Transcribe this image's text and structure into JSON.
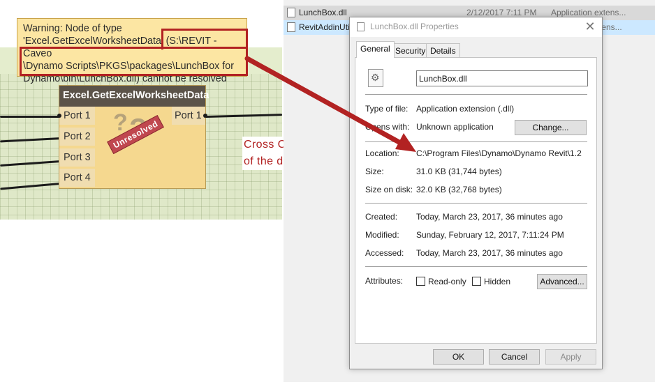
{
  "dynamo": {
    "warning": {
      "text": "Warning: Node of type\n'Excel.GetExcelWorksheetData' (S:\\REVIT - Caveo\n\\Dynamo Scripts\\PKGS\\packages\\LunchBox for\nDynamo\\bin\\LunchBox.dll) cannot be resolved"
    },
    "node": {
      "title": "Excel.GetExcelWorksheetData",
      "inputs": [
        "Port 1",
        "Port 2",
        "Port 3",
        "Port 4"
      ],
      "output": "Port 1",
      "unresolved_stamp": "Unresolved",
      "placeholder_glyph": "?"
    }
  },
  "annotation": {
    "text": "Cross Check the path\nof the dll.",
    "color": "#b22222"
  },
  "explorer": {
    "files": [
      {
        "name": "LunchBox.dll",
        "date": "2/12/2017 7:11 PM",
        "type": "Application extens..."
      },
      {
        "name": "RevitAddinUti",
        "date": "",
        "type": "xtens..."
      }
    ]
  },
  "dialog": {
    "title": "LunchBox.dll Properties",
    "tabs": [
      "General",
      "Security",
      "Details"
    ],
    "active_tab": "General",
    "filename": "LunchBox.dll",
    "props": {
      "type_label": "Type of file:",
      "type_value": "Application extension (.dll)",
      "opens_label": "Opens with:",
      "opens_value": "Unknown application",
      "change_button": "Change...",
      "location_label": "Location:",
      "location_value": "C:\\Program Files\\Dynamo\\Dynamo Revit\\1.2",
      "size_label": "Size:",
      "size_value": "31.0 KB (31,744 bytes)",
      "disk_label": "Size on disk:",
      "disk_value": "32.0 KB (32,768 bytes)",
      "created_label": "Created:",
      "created_value": "Today, March 23, 2017, 36 minutes ago",
      "modified_label": "Modified:",
      "modified_value": "Sunday, February 12, 2017, 7:11:24 PM",
      "accessed_label": "Accessed:",
      "accessed_value": "Today, March 23, 2017, 36 minutes ago",
      "attributes_label": "Attributes:",
      "readonly_label": "Read-only",
      "hidden_label": "Hidden",
      "advanced_button": "Advanced..."
    },
    "buttons": {
      "ok": "OK",
      "cancel": "Cancel",
      "apply": "Apply"
    }
  },
  "colors": {
    "highlight_red": "#b22222",
    "node_header": "#5b5349",
    "node_body": "#f5d88f",
    "warning_bg": "#fce6a3",
    "canvas_bg": "#dfe8c8"
  }
}
